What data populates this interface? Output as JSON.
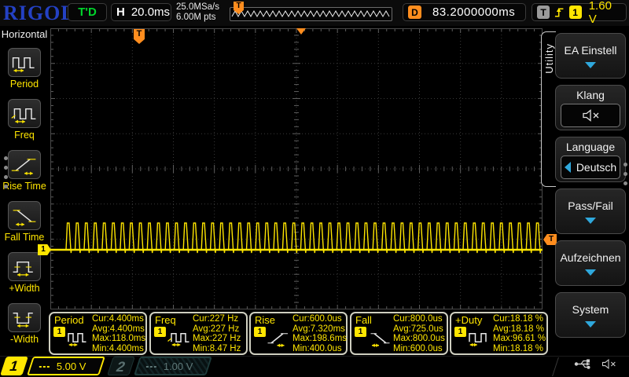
{
  "top_bar": {
    "logo": "RIGOL",
    "trigger_status": "T'D",
    "horizontal_label": "H",
    "timebase": "20.0ms",
    "sample_rate": "25.0MSa/s",
    "memory_depth": "6.00M pts",
    "delay_label": "D",
    "delay_value": "83.2000000ms",
    "trigger_label": "T",
    "trigger_source": "1",
    "trigger_level": "1.60 V"
  },
  "left_menu": {
    "title": "Horizontal",
    "items": [
      {
        "label": "Period",
        "icon": "period-icon"
      },
      {
        "label": "Freq",
        "icon": "freq-icon"
      },
      {
        "label": "Rise Time",
        "icon": "rise-time-icon"
      },
      {
        "label": "Fall Time",
        "icon": "fall-time-icon"
      },
      {
        "label": "+Width",
        "icon": "plus-width-icon"
      },
      {
        "label": "-Width",
        "icon": "minus-width-icon"
      }
    ]
  },
  "right_menu": {
    "tab_label": "Utility",
    "buttons": [
      {
        "label": "EA Einstell",
        "has_dropdown": true
      },
      {
        "label": "Klang",
        "icon": "speaker-muted-icon"
      },
      {
        "label": "Language",
        "value": "Deutsch"
      },
      {
        "label": "Pass/Fail",
        "has_dropdown": true
      },
      {
        "label": "Aufzeichnen",
        "has_dropdown": true
      },
      {
        "label": "System",
        "has_dropdown": true
      }
    ]
  },
  "measurements": [
    {
      "name": "Period",
      "source": "1",
      "cur": "Cur:4.400ms",
      "avg": "Avg:4.400ms",
      "max": "Max:118.0ms",
      "min": "Min:4.400ms"
    },
    {
      "name": "Freq",
      "source": "1",
      "cur": "Cur:227 Hz",
      "avg": "Avg:227 Hz",
      "max": "Max:227 Hz",
      "min": "Min:8.47 Hz"
    },
    {
      "name": "Rise",
      "source": "1",
      "cur": "Cur:600.0us",
      "avg": "Avg:7.320ms",
      "max": "Max:198.6ms",
      "min": "Min:400.0us"
    },
    {
      "name": "Fall",
      "source": "1",
      "cur": "Cur:800.0us",
      "avg": "Avg:725.0us",
      "max": "Max:800.0us",
      "min": "Min:600.0us"
    },
    {
      "name": "+Duty",
      "source": "1",
      "cur": "Cur:18.18 %",
      "avg": "Avg:18.18 %",
      "max": "Max:96.61 %",
      "min": "Min:18.18 %"
    }
  ],
  "channels": [
    {
      "id": "1",
      "scale": "5.00 V",
      "active": true
    },
    {
      "id": "2",
      "scale": "1.00 V",
      "active": false
    }
  ],
  "markers": {
    "grid_trigger_flag": "T",
    "trigger_level_marker": "T",
    "ch1_ground_marker": "1"
  },
  "waveform": {
    "type": "pulse-train",
    "channel": "1",
    "period_ms": 4.4,
    "duty_pct": 18.18,
    "timebase_ms_per_div": 20,
    "volts_per_div": 5.0
  },
  "colors": {
    "ch1": "#ffe600",
    "ch2_dim": "#5f7777",
    "orange": "#ff8d1e",
    "green": "#00d52c",
    "menu_arrow_blue": "#2fa8dc",
    "logo_blue": "#2441c4",
    "grid_dot": "#3a3a3a",
    "grid_tick": "#5d5d5d"
  }
}
